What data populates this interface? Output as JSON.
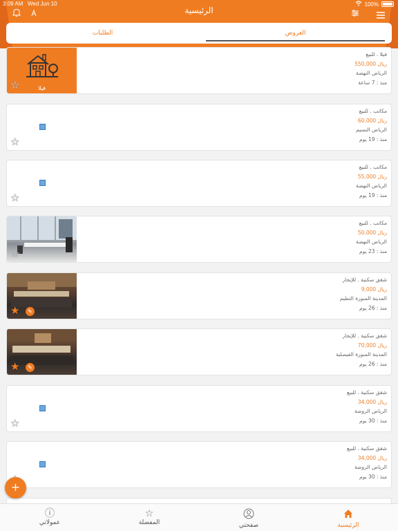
{
  "status": {
    "time": "3:09 AM",
    "date": "Wed Jun 10",
    "battery": "100%"
  },
  "header": {
    "title": "الرئيسية"
  },
  "tabs": [
    {
      "label": "الطلبات"
    },
    {
      "label": "العروض"
    }
  ],
  "listings": [
    {
      "kind": "فيلا . للبيع",
      "price": "550,000 ريال",
      "location": "الرياض النهضة",
      "ago": "منذ : 7 ساعة",
      "image_caption": "فيلا"
    },
    {
      "kind": "مكاتب . للبيع",
      "price": "60,000 ريال",
      "location": "الرياض النسيم",
      "ago": "منذ : 19 يوم"
    },
    {
      "kind": "مكاتب . للبيع",
      "price": "55,000 ريال",
      "location": "الرياض النهضة",
      "ago": "منذ : 19 يوم"
    },
    {
      "kind": "مكاتب . للبيع",
      "price": "50,000 ريال",
      "location": "الرياض النهضة",
      "ago": "منذ : 23 يوم"
    },
    {
      "kind": "شقق سكنية . للإيجار",
      "price": "9,000 ريال",
      "location": "المدينة المنورة التطيم",
      "ago": "منذ : 26 يوم"
    },
    {
      "kind": "شقق سكنية . للإيجار",
      "price": "70,000 ريال",
      "location": "المدينة المنورة الفيصلية",
      "ago": "منذ : 26 يوم"
    },
    {
      "kind": "شقق سكنية . للبيع",
      "price": "34,000 ريال",
      "location": "الرياض الروضة",
      "ago": "منذ : 30 يوم"
    },
    {
      "kind": "شقق سكنية . للبيع",
      "price": "34,000 ريال",
      "location": "الرياض الروضة",
      "ago": "منذ : 30 يوم"
    }
  ],
  "fab": {
    "label": "+"
  },
  "bottom_nav": [
    {
      "label": "عمولاتي",
      "icon": "info-icon"
    },
    {
      "label": "المفضلة",
      "icon": "star-icon"
    },
    {
      "label": "صفحتي",
      "icon": "user-icon"
    },
    {
      "label": "الرئيسية",
      "icon": "home-icon"
    }
  ],
  "colors": {
    "accent": "#f07c22",
    "background": "#f2f2f2"
  }
}
